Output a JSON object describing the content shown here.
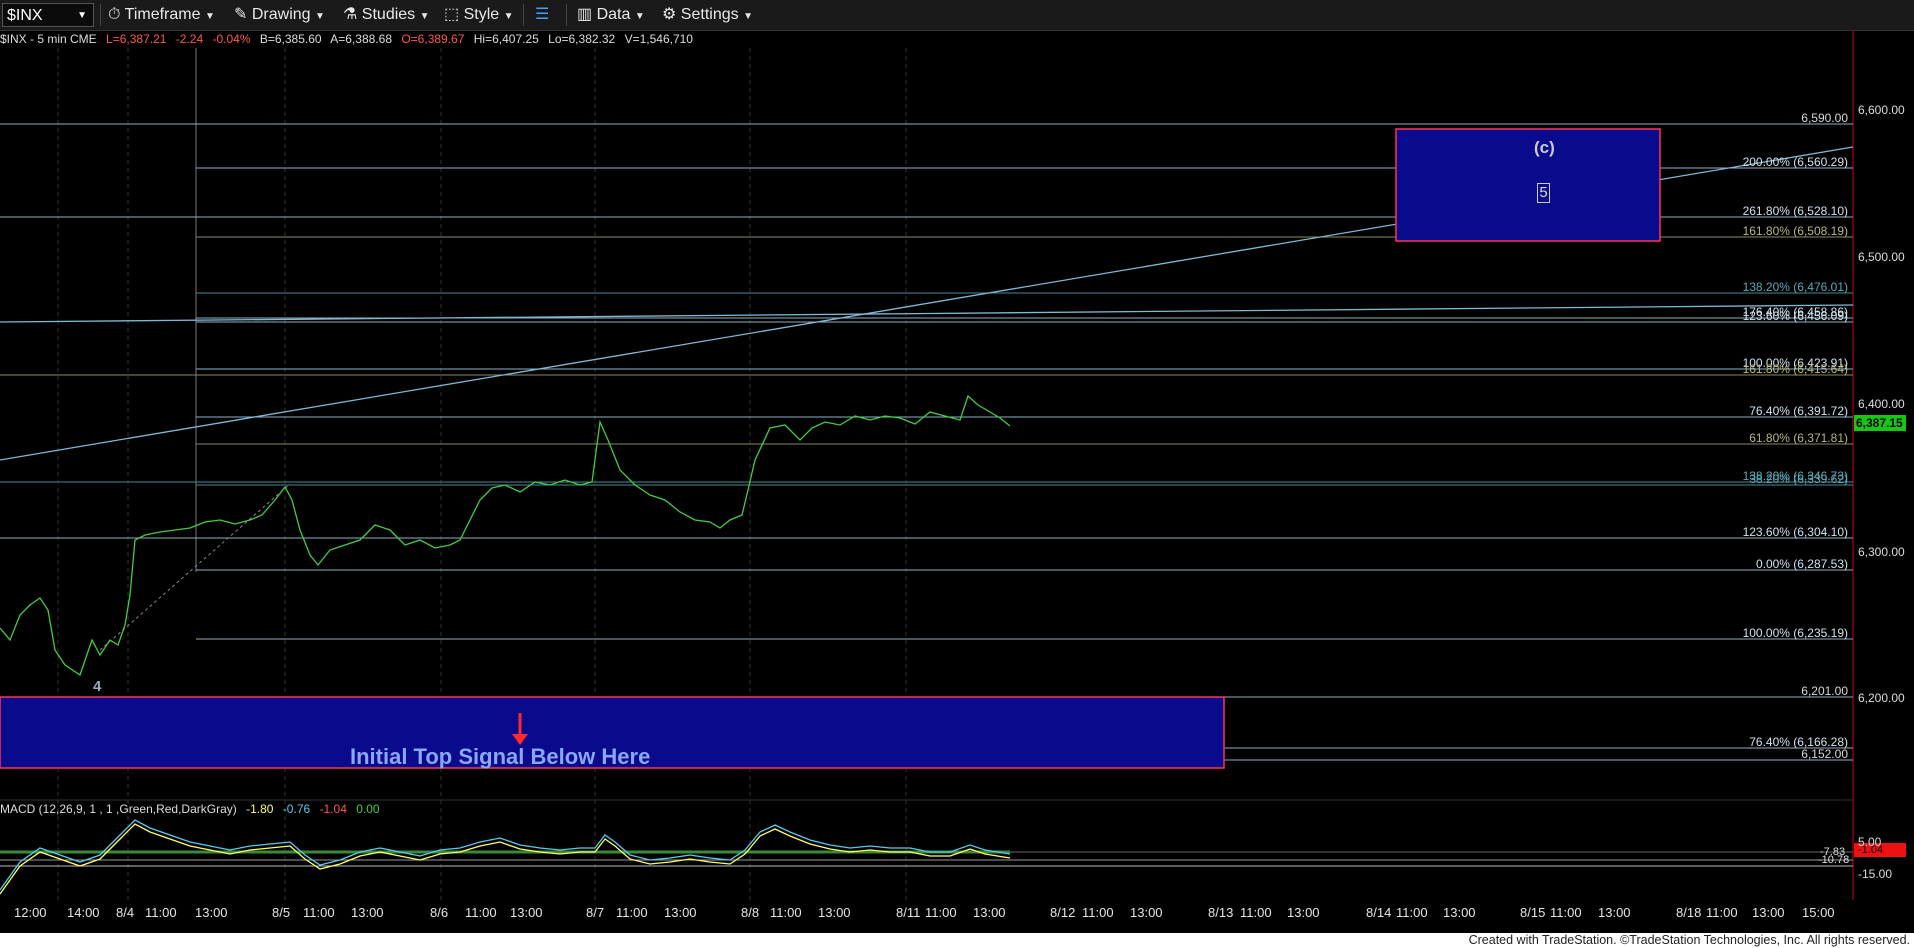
{
  "toolbar": {
    "symbol": "$INX",
    "timeframe": "Timeframe",
    "drawing": "Drawing",
    "studies": "Studies",
    "style": "Style",
    "data": "Data",
    "settings": "Settings"
  },
  "infobar": {
    "symbol_desc": "$INX - 5 min  CME",
    "last": "L=6,387.21",
    "change": "-2.24",
    "pct": "-0.04%",
    "bid": "B=6,385.60",
    "ask": "A=6,388.68",
    "open": "O=6,389.67",
    "high": "Hi=6,407.25",
    "low": "Lo=6,382.32",
    "volume": "V=1,546,710"
  },
  "colors": {
    "bull": "#44cc44",
    "bear": "#ff3333",
    "fib_blue": "#7fb9d6",
    "fib_olive": "#b8b878",
    "box_blue": "#0a0a8c",
    "box_border": "#ff3355",
    "price_tag": "#14c814"
  },
  "price_axis": [
    "6,600.00",
    "6,500.00",
    "6,400.00",
    "6,300.00",
    "6,200.00"
  ],
  "current_price": "6,387.15",
  "levels": [
    {
      "label": "6,590.00",
      "kind": "plain"
    },
    {
      "label": "200.00% (6,560.29)",
      "kind": "fib"
    },
    {
      "label": "261.80% (6,528.10)",
      "kind": "fib"
    },
    {
      "label": "161.80% (6,508.19)",
      "kind": "olive"
    },
    {
      "label": "138.20% (6,476.01)",
      "kind": "teal"
    },
    {
      "label": "176.40% (6,458.86)",
      "kind": "fib"
    },
    {
      "label": "123.60% (6,456.09)",
      "kind": "fib"
    },
    {
      "label": "100.00% (6,423.91)",
      "kind": "fib"
    },
    {
      "label": "161.80% (6,415.64)",
      "kind": "olive"
    },
    {
      "label": "76.40% (6,391.72)",
      "kind": "fib"
    },
    {
      "label": "61.80% (6,371.81)",
      "kind": "olive"
    },
    {
      "label": "138.20% (6,346.73)",
      "kind": "teal"
    },
    {
      "label": "38.20% (6,339.62)",
      "kind": "teal"
    },
    {
      "label": "123.60% (6,304.10)",
      "kind": "fib"
    },
    {
      "label": "0.00% (6,287.53)",
      "kind": "fib"
    },
    {
      "label": "100.00% (6,235.19)",
      "kind": "fib"
    },
    {
      "label": "6,201.00",
      "kind": "plain"
    },
    {
      "label": "76.40% (6,166.28)",
      "kind": "fib"
    },
    {
      "label": "6,152.00",
      "kind": "plain"
    }
  ],
  "annotations": {
    "wave_c": "(c)",
    "wave_5": "5",
    "wave_4": "4",
    "signal_text": "Initial Top Signal Below Here"
  },
  "macd": {
    "title": "MACD (12,26,9, 1 , 1 ,Green,Red,DarkGray)",
    "v1": "-1.80",
    "v2": "-0.76",
    "v3": "-1.04",
    "v4": "0.00",
    "axis_top": "5.00",
    "axis_bottom": "-15.00",
    "tag1": "-7.83",
    "tag2": "-10.78",
    "tag3": "-1.04"
  },
  "time_axis": [
    "12:00",
    "14:00",
    "8/4",
    "11:00",
    "13:00",
    "8/5",
    "11:00",
    "13:00",
    "8/6",
    "11:00",
    "13:00",
    "8/7",
    "11:00",
    "13:00",
    "8/8",
    "11:00",
    "13:00",
    "8/11",
    "11:00",
    "13:00",
    "8/12",
    "11:00",
    "13:00",
    "8/13",
    "11:00",
    "13:00",
    "8/14",
    "11:00",
    "13:00",
    "8/15",
    "11:00",
    "13:00",
    "8/18",
    "11:00",
    "13:00",
    "15:00"
  ],
  "footer": "Created with TradeStation. ©TradeStation Technologies, Inc. All rights reserved."
}
